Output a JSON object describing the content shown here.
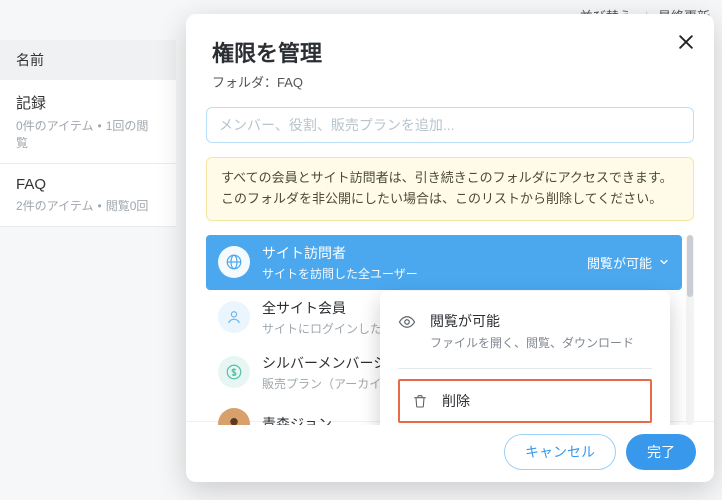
{
  "background": {
    "sort_label": "並び替え:",
    "sort_value": "最終更新",
    "section": "名前",
    "items": [
      {
        "title": "記録",
        "sub1": "0件のアイテム",
        "sub2": "1回の閲覧"
      },
      {
        "title": "FAQ",
        "sub1": "2件のアイテム",
        "sub2": "閲覧0回"
      }
    ]
  },
  "modal": {
    "title": "権限を管理",
    "subtitle_label": "フォルダ：",
    "subtitle_value": "FAQ",
    "search_placeholder": "メンバー、役割、販売プランを追加...",
    "notice": "すべての会員とサイト訪問者は、引き続きこのフォルダにアクセスできます。このフォルダを非公開にしたい場合は、このリストから削除してください。",
    "rows": [
      {
        "title": "サイト訪問者",
        "sub": "サイトを訪問した全ユーザー",
        "permission": "閲覧が可能"
      },
      {
        "title": "全サイト会員",
        "sub": "サイトにログインした"
      },
      {
        "title": "シルバーメンバーシ",
        "sub": "販売プラン（アーカイ"
      },
      {
        "title": "青森ジョン",
        "sub": ""
      }
    ],
    "dropdown": {
      "view_title": "閲覧が可能",
      "view_desc": "ファイルを開く、閲覧、ダウンロード",
      "delete": "削除"
    },
    "buttons": {
      "cancel": "キャンセル",
      "done": "完了"
    }
  },
  "icons": {
    "close": "close-icon",
    "globe": "globe-icon",
    "person": "person-icon",
    "dollar": "dollar-icon",
    "avatar": "avatar-icon",
    "chevron_down": "chevron-down-icon",
    "eye": "eye-icon",
    "trash": "trash-icon"
  },
  "colors": {
    "accent": "#3899ec",
    "row_active": "#4ba8ef",
    "notice_bg": "#fffbe8",
    "notice_border": "#f5e6a3",
    "delete_border": "#e86a46"
  }
}
